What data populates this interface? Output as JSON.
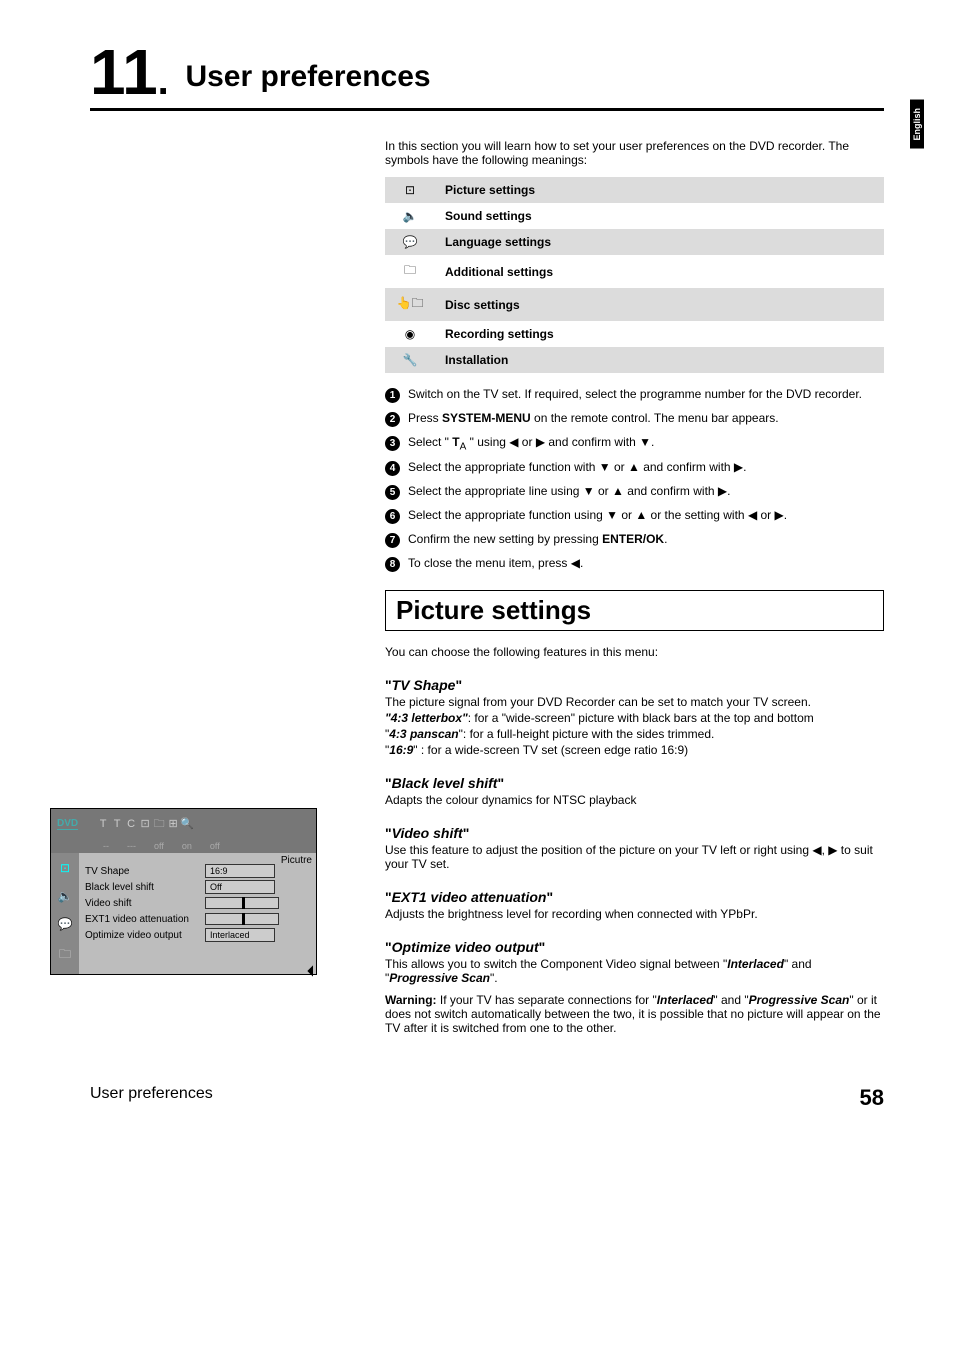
{
  "side_tab": "English",
  "chapter": {
    "number": "11",
    "dot": ".",
    "title": "User preferences"
  },
  "intro": "In this section you will learn how to set your user preferences on the DVD recorder. The symbols have the following meanings:",
  "symbols": [
    {
      "icon": "⊡",
      "label": "Picture settings"
    },
    {
      "icon": "🔈",
      "label": "Sound settings"
    },
    {
      "icon": "💬",
      "label": "Language settings"
    },
    {
      "icon": "🗀",
      "label": "Additional settings"
    },
    {
      "icon": "👆🗀",
      "label": "Disc settings"
    },
    {
      "icon": "◉",
      "label": "Recording settings"
    },
    {
      "icon": "🔧",
      "label": "Installation"
    }
  ],
  "steps": [
    "Switch on the TV set. If required, select the programme number for the DVD recorder.",
    "Press <b>SYSTEM-MENU</b> on the remote control. The menu bar appears.",
    "Select \" <b>T</b><sub>A</sub> \" using ◀ or ▶ and confirm with ▼.",
    "Select the appropriate function with ▼ or ▲ and confirm with ▶.",
    "Select the appropriate line using ▼ or ▲ and confirm with ▶.",
    "Select the appropriate function using ▼ or ▲ or the setting with ◀ or ▶.",
    "Confirm the new setting by pressing <b>ENTER/OK</b>.",
    "To close the menu item, press ◀."
  ],
  "section_title": "Picture settings",
  "section_intro": "You can choose the following features in this menu:",
  "tv_shape": {
    "head": "TV Shape",
    "p1": "The picture signal from your DVD Recorder can be set to match your TV screen.",
    "p2": "<b><i>\"4:3 letterbox\"</i></b>: for a \"wide-screen\" picture with black bars at the top and bottom",
    "p3": "\"<b><i>4:3 panscan</i></b>\": for a full-height picture with the sides trimmed.",
    "p4": "\"<b><i>16:9</i></b>\" : for a wide-screen TV set (screen edge ratio 16:9)"
  },
  "black_level": {
    "head": "Black level shift",
    "p": "Adapts the colour dynamics for NTSC playback"
  },
  "video_shift": {
    "head": "Video shift",
    "p": "Use this feature to adjust the position of the picture on your TV left or right using ◀, ▶ to suit your TV set."
  },
  "ext1": {
    "head": "EXT1 video attenuation",
    "p": "Adjusts the brightness level for recording when connected with YPbPr."
  },
  "opt_out": {
    "head": "Optimize video output",
    "p1": "This allows you to switch the Component Video signal between \"<b><i>Interlaced</i></b>\" and \"<b><i>Progressive Scan</i></b>\".",
    "p2": "<b>Warning:</b> If your TV has separate connections for \"<b><i>Interlaced</i></b>\" and \"<b><i>Progressive Scan</i></b>\" or it does not switch automatically between the two, it is possible that no picture will appear on the TV after it is switched from one to the other."
  },
  "osd": {
    "top_glyphs": [
      "T",
      "T",
      "C",
      "⊡",
      "🗀",
      "⊞",
      "🔍"
    ],
    "row2": [
      "--",
      "---",
      "off",
      "on",
      "off"
    ],
    "dvd_label": "DVD",
    "sidebar_icons": [
      "⊡",
      "🔈",
      "💬",
      "🗀"
    ],
    "corner": "Picutre",
    "lines": [
      {
        "label": "TV Shape",
        "value": "16:9",
        "type": "val"
      },
      {
        "label": "Black level shift",
        "value": "Off",
        "type": "val"
      },
      {
        "label": "Video shift",
        "value": "",
        "type": "slider"
      },
      {
        "label": "EXT1 video attenuation",
        "value": "",
        "type": "slider"
      },
      {
        "label": "Optimize video output",
        "value": "Interlaced",
        "type": "val"
      }
    ]
  },
  "footer": {
    "left": "User preferences",
    "right": "58"
  }
}
